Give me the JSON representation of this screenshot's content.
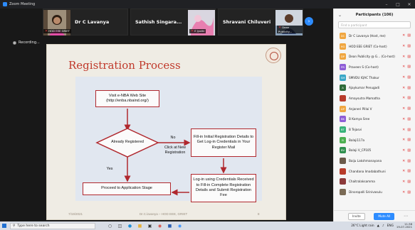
{
  "window": {
    "title": "Zoom Meeting"
  },
  "gallery": {
    "tiles": [
      {
        "name": "Dr C Lavanya",
        "thumb_label": "HOD EEE GRIET"
      },
      {
        "name": "Sathish Singara...",
        "thumb_label": "E Jyothi"
      },
      {
        "name": "Shravani Chiluveri",
        "thumb_label": "Dean Publicity..."
      }
    ],
    "next_icon": "chevron-right-icon"
  },
  "recording": {
    "label": "Recording..."
  },
  "slide": {
    "title": "Registration Process",
    "flow": {
      "visit": "Visit e-NBA Web Site (http://enba.nbaind.org/)",
      "decision": "Already Registered",
      "fill_initial": "Fill-in Initial Registration Details to Get Log-in Credentials in Your Register Mail",
      "login": "Log-in using Credentials Received to Fill-in Complete Registration Details and Submit Registration Fee",
      "proceed": "Proceed to Application Stage",
      "no_label": "No",
      "yes_label": "Yes",
      "click_label": "Click at New Registration"
    },
    "footer_date": "7/19/2021",
    "footer_center": "Dr.C.lavanya – HOD EEE, GRIET",
    "footer_page": "8"
  },
  "panel": {
    "title": "Participants (106)",
    "search_placeholder": "Find a participant",
    "participants": [
      {
        "initials": "DC",
        "name": "Dr C Lavanya (Host, me)",
        "color": "#f0a640"
      },
      {
        "initials": "HG",
        "name": "HOD EEE GRIET (Co-host)",
        "color": "#f0a640"
      },
      {
        "initials": "DP",
        "name": "Dean Publicity @ G... (Co-host)",
        "color": "#f0a640"
      },
      {
        "initials": "PR",
        "name": "Praveen S (Co-host)",
        "color": "#8e5dd6"
      },
      {
        "initials": "SM",
        "name": "SMVDU IQAC Thakur",
        "color": "#3aa7c7"
      },
      {
        "initials": "A",
        "name": "Ajaykumar Penugadi",
        "color": "#2f6b3a"
      },
      {
        "initials": "",
        "name": "Amaysutra Mamatha",
        "color": "#b83b2a"
      },
      {
        "initials": "AP",
        "name": "Anjaneri Pillai V",
        "color": "#f0a640"
      },
      {
        "initials": "BK",
        "name": "B Kamya Sree",
        "color": "#8e5dd6"
      },
      {
        "initials": "BT",
        "name": "B Tejasvi",
        "color": "#38b27a"
      },
      {
        "initials": "B",
        "name": "Balaji117a",
        "color": "#4caf50"
      },
      {
        "initials": "BV",
        "name": "Balaji V_CP105",
        "color": "#2f8f4e"
      },
      {
        "initials": "",
        "name": "Baiju Lakshmanayana",
        "color": "#6b5a4a"
      },
      {
        "initials": "",
        "name": "Chandana Imadabathuni",
        "color": "#b83b2a"
      },
      {
        "initials": "",
        "name": "Chaitralaksamma",
        "color": "#8c3a3a"
      },
      {
        "initials": "",
        "name": "Dinoropalli Srinivasulu",
        "color": "#7a6a55"
      }
    ],
    "invite_label": "Invite",
    "mute_all_label": "Mute All"
  },
  "taskbar": {
    "search_placeholder": "Type here to search",
    "weather": "26°C Light rain",
    "language": "ENG",
    "time": "11:38",
    "date": "19-07-2021"
  },
  "colors": {
    "accent": "#2d8cff",
    "flow_border": "#b0282e",
    "slide_title": "#c0392b"
  }
}
